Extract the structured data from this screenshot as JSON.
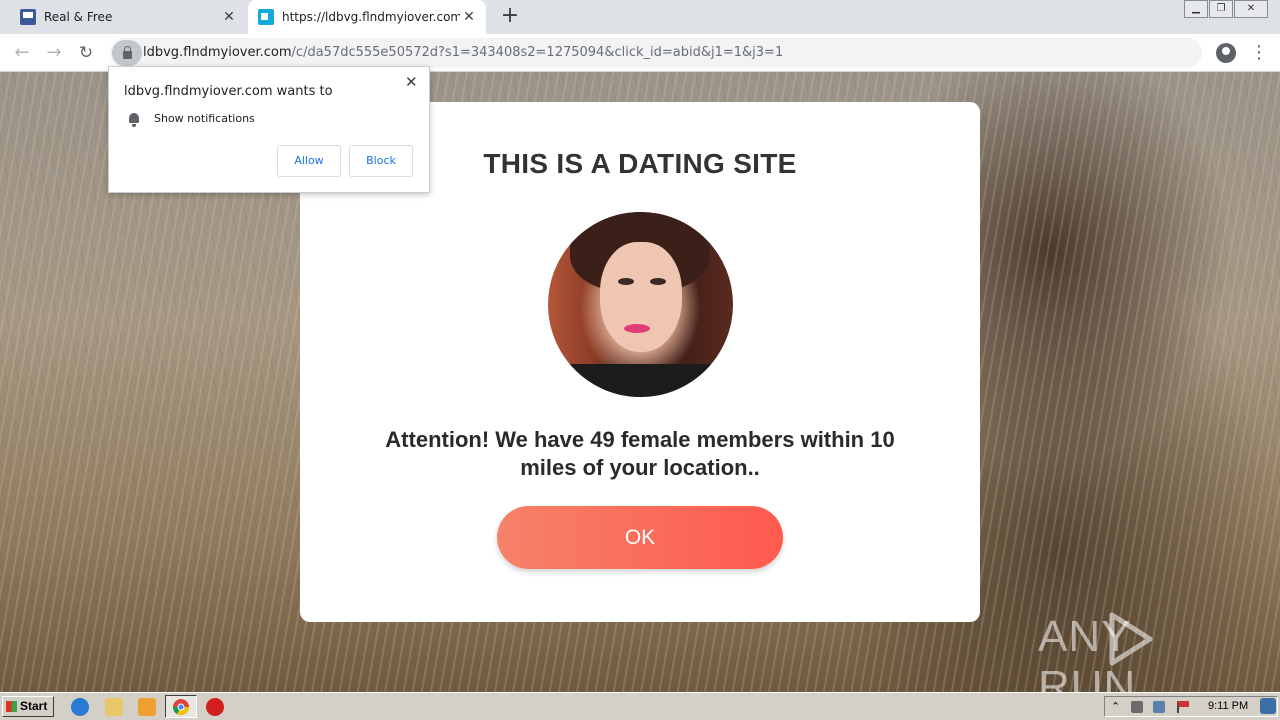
{
  "browser": {
    "tabs": [
      {
        "title": "Real & Free",
        "active": false
      },
      {
        "title": "https://ldbvg.flndmyiover.com/c/da",
        "active": true
      }
    ],
    "url_host": "ldbvg.flndmyiover.com",
    "url_rest": "/c/da57dc555e50572d?s1=343408s2=1275094&click_id=abid&j1=1&j3=1"
  },
  "notification_prompt": {
    "title": "ldbvg.flndmyiover.com wants to",
    "permission": "Show notifications",
    "allow_label": "Allow",
    "block_label": "Block"
  },
  "modal": {
    "title": "THIS IS A DATING SITE",
    "message": "Attention! We have 49 female members within 10 miles of your location..",
    "ok_label": "OK"
  },
  "watermark": {
    "left": "ANY",
    "right": "RUN"
  },
  "taskbar": {
    "start_label": "Start",
    "clock": "9:11 PM"
  },
  "colors": {
    "ok_button_start": "#f5826a",
    "ok_button_end": "#ff5a4e",
    "link_blue": "#1a73e8"
  }
}
